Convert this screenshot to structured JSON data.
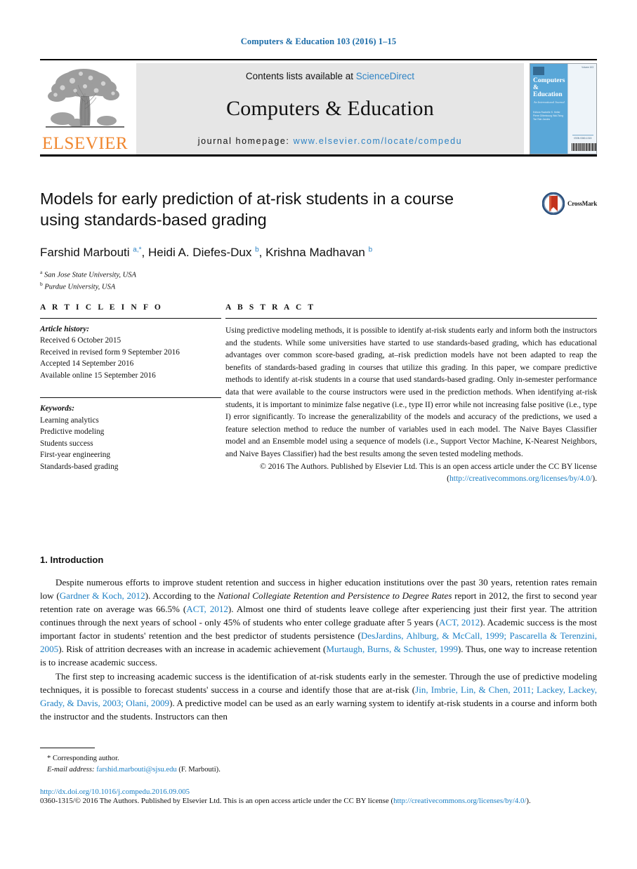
{
  "running_head": "Computers & Education 103 (2016) 1–15",
  "masthead": {
    "publisher_wordmark": "ELSEVIER",
    "contents_prefix": "Contents lists available at",
    "contents_link": "ScienceDirect",
    "journal_title": "Computers & Education",
    "homepage_prefix": "journal homepage:",
    "homepage_url": "www.elsevier.com/locate/compedu",
    "cover": {
      "line1": "Computers",
      "amp": "&",
      "line2": "Education",
      "subtitle": "An International Journal",
      "editors": "Editors\nRachelle S. Heller\nPierre Dillenbourg\nWai-Tsing Tse\nRab Jacobs",
      "issn": "ISSN 0360-1315",
      "top_number": "Volume 103"
    }
  },
  "article": {
    "title": "Models for early prediction of at-risk students in a course using standards-based grading",
    "authors_html": "Farshid Marbouti <sup>a,</sup><sup>*</sup>, Heidi A. Diefes-Dux <sup>b</sup>, Krishna Madhavan <sup>b</sup>",
    "affiliation_a": "San Jose State University, USA",
    "affiliation_b": "Purdue University, USA",
    "crossmark_label": "CrossMark"
  },
  "article_info": {
    "heading": "A R T I C L E  I N F O",
    "history_label": "Article history:",
    "history": [
      "Received 6 October 2015",
      "Received in revised form 9 September 2016",
      "Accepted 14 September 2016",
      "Available online 15 September 2016"
    ],
    "keywords_label": "Keywords:",
    "keywords": [
      "Learning analytics",
      "Predictive modeling",
      "Students success",
      "First-year engineering",
      "Standards-based grading"
    ]
  },
  "abstract": {
    "heading": "A B S T R A C T",
    "text": "Using predictive modeling methods, it is possible to identify at-risk students early and inform both the instructors and the students. While some universities have started to use standards-based grading, which has educational advantages over common score-based grading, at–risk prediction models have not been adapted to reap the benefits of standards-based grading in courses that utilize this grading. In this paper, we compare predictive methods to identify at-risk students in a course that used standards-based grading. Only in-semester performance data that were available to the course instructors were used in the prediction methods. When identifying at-risk students, it is important to minimize false negative (i.e., type II) error while not increasing false positive (i.e., type I) error significantly. To increase the generalizability of the models and accuracy of the predictions, we used a feature selection method to reduce the number of variables used in each model. The Naive Bayes Classifier model and an Ensemble model using a sequence of models (i.e., Support Vector Machine, K-Nearest Neighbors, and Naive Bayes Classifier) had the best results among the seven tested modeling methods.",
    "copyright_text": "© 2016 The Authors. Published by Elsevier Ltd. This is an open access article under the CC BY license (",
    "copyright_link": "http://creativecommons.org/licenses/by/4.0/",
    "copyright_tail": ")."
  },
  "introduction": {
    "heading": "1. Introduction",
    "paragraph1": {
      "s1": "Despite numerous efforts to improve student retention and success in higher education institutions over the past 30 years, retention rates remain low (",
      "c1": "Gardner & Koch, 2012",
      "s2": "). According to the ",
      "i1": "National Collegiate Retention and Persistence to Degree Rates",
      "s3": " report in 2012, the first to second year retention rate on average was 66.5% (",
      "c2": "ACT, 2012",
      "s4": "). Almost one third of students leave college after experiencing just their first year. The attrition continues through the next years of school - only 45% of students who enter college graduate after 5 years (",
      "c3": "ACT, 2012",
      "s5": "). Academic success is the most important factor in students' retention and the best predictor of students persistence (",
      "c4": "DesJardins, Ahlburg, & McCall, 1999; Pascarella & Terenzini, 2005",
      "s6": "). Risk of attrition decreases with an increase in academic achievement (",
      "c5": "Murtaugh, Burns, & Schuster, 1999",
      "s7": "). Thus, one way to increase retention is to increase academic success."
    },
    "paragraph2": {
      "s1": "The first step to increasing academic success is the identification of at-risk students early in the semester. Through the use of predictive modeling techniques, it is possible to forecast students' success in a course and identify those that are at-risk (",
      "c1": "Jin, Imbrie, Lin, & Chen, 2011; Lackey, Lackey, Grady, & Davis, 2003; Olani, 2009",
      "s2": "). A predictive model can be used as an early warning system to identify at-risk students in a course and inform both the instructor and the students. Instructors can then"
    }
  },
  "footer": {
    "corresponding": "* Corresponding author.",
    "email_label": "E-mail address:",
    "email": "farshid.marbouti@sjsu.edu",
    "email_suffix": "(F. Marbouti).",
    "doi": "http://dx.doi.org/10.1016/j.compedu.2016.09.005",
    "copyright_prefix": "0360-1315/© 2016 The Authors. Published by Elsevier Ltd. This is an open access article under the CC BY license (",
    "copyright_link": "http://creativecommons.org/licenses/by/4.0/",
    "copyright_tail": ")."
  },
  "colors": {
    "link_blue": "#1b7fc4",
    "sciencedirect_blue": "#2e83c4",
    "elsevier_orange": "#f0862e",
    "cover_blue": "#59a7d8",
    "crossmark_red": "#c3341d"
  }
}
